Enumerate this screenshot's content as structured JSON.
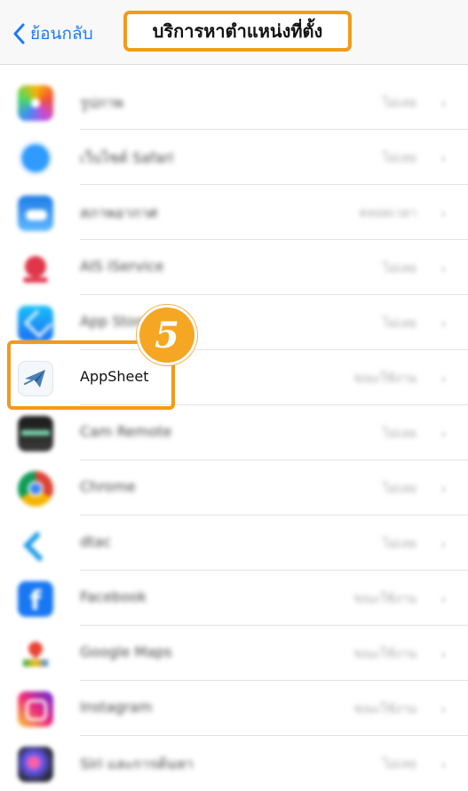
{
  "nav": {
    "back_label": "ย้อนกลับ",
    "title": "บริการหาตำแหน่งที่ตั้ง"
  },
  "annotation": {
    "step_number": "5",
    "accent_color": "#f39a1b"
  },
  "apps": [
    {
      "icon": "photos-icon",
      "name": "รูปภาพ",
      "status": "ไม่เลย",
      "blurred": true
    },
    {
      "icon": "safari-icon",
      "name": "เว็บไซต์ Safari",
      "status": "ไม่เลย",
      "blurred": true
    },
    {
      "icon": "weather-icon",
      "name": "สภาพอากาศ",
      "status": "ตลอดเวลา",
      "blurred": true
    },
    {
      "icon": "ais-service-icon",
      "name": "AIS iService",
      "status": "ไม่เลย",
      "blurred": true
    },
    {
      "icon": "app-store-icon",
      "name": "App Store",
      "status": "ไม่เลย",
      "blurred": true
    },
    {
      "icon": "appsheet-icon",
      "name": "AppSheet",
      "status": "ขณะใช้งาน",
      "blurred": false
    },
    {
      "icon": "cam-remote-icon",
      "name": "Cam Remote",
      "status": "ไม่เลย",
      "blurred": true
    },
    {
      "icon": "chrome-icon",
      "name": "Chrome",
      "status": "ไม่เลย",
      "blurred": true
    },
    {
      "icon": "dtac-icon",
      "name": "dtac",
      "status": "ไม่เลย",
      "blurred": true
    },
    {
      "icon": "facebook-icon",
      "name": "Facebook",
      "status": "ขณะใช้งาน",
      "blurred": true
    },
    {
      "icon": "google-maps-icon",
      "name": "Google Maps",
      "status": "ขณะใช้งาน",
      "blurred": true
    },
    {
      "icon": "instagram-icon",
      "name": "Instagram",
      "status": "ขณะใช้งาน",
      "blurred": true
    },
    {
      "icon": "siri-icon",
      "name": "Siri และการค้นหา",
      "status": "ไม่เลย",
      "blurred": true
    }
  ]
}
